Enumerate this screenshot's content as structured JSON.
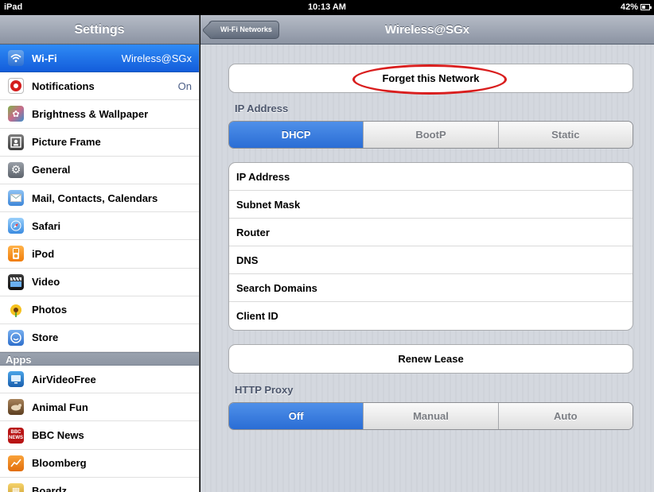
{
  "status_bar": {
    "carrier": "iPad",
    "time": "10:13 AM",
    "battery": "42%"
  },
  "sidebar": {
    "title": "Settings",
    "items": [
      {
        "label": "Wi-Fi",
        "value": "Wireless@SGx",
        "icon": "wifi-icon",
        "selected": true
      },
      {
        "label": "Notifications",
        "value": "On",
        "icon": "notifications-icon"
      },
      {
        "label": "Brightness & Wallpaper",
        "value": "",
        "icon": "brightness-icon"
      },
      {
        "label": "Picture Frame",
        "value": "",
        "icon": "picture-frame-icon"
      },
      {
        "label": "General",
        "value": "",
        "icon": "general-gear-icon"
      },
      {
        "label": "Mail, Contacts, Calendars",
        "value": "",
        "icon": "mail-icon"
      },
      {
        "label": "Safari",
        "value": "",
        "icon": "safari-compass-icon"
      },
      {
        "label": "iPod",
        "value": "",
        "icon": "ipod-icon"
      },
      {
        "label": "Video",
        "value": "",
        "icon": "video-icon"
      },
      {
        "label": "Photos",
        "value": "",
        "icon": "photos-sunflower-icon"
      },
      {
        "label": "Store",
        "value": "",
        "icon": "store-icon"
      }
    ],
    "apps_header": "Apps",
    "apps": [
      {
        "label": "AirVideoFree",
        "icon": "airvideo-icon"
      },
      {
        "label": "Animal Fun",
        "icon": "animal-fun-icon"
      },
      {
        "label": "BBC News",
        "icon": "bbc-news-icon"
      },
      {
        "label": "Bloomberg",
        "icon": "bloomberg-icon"
      },
      {
        "label": "Boardz",
        "icon": "boardz-icon"
      }
    ]
  },
  "detail": {
    "title": "Wireless@SGx",
    "back_label": "Wi-Fi Networks",
    "forget_label": "Forget this Network",
    "ip_section_label": "IP Address",
    "ip_modes": [
      {
        "label": "DHCP",
        "active": true
      },
      {
        "label": "BootP",
        "active": false
      },
      {
        "label": "Static",
        "active": false
      }
    ],
    "ip_rows": [
      "IP Address",
      "Subnet Mask",
      "Router",
      "DNS",
      "Search Domains",
      "Client ID"
    ],
    "renew_label": "Renew Lease",
    "proxy_section_label": "HTTP Proxy",
    "proxy_modes": [
      {
        "label": "Off",
        "active": true
      },
      {
        "label": "Manual",
        "active": false
      },
      {
        "label": "Auto",
        "active": false
      }
    ]
  },
  "colors": {
    "selection_blue": "#1e6ee6",
    "annotation_red": "#d91e1e"
  }
}
